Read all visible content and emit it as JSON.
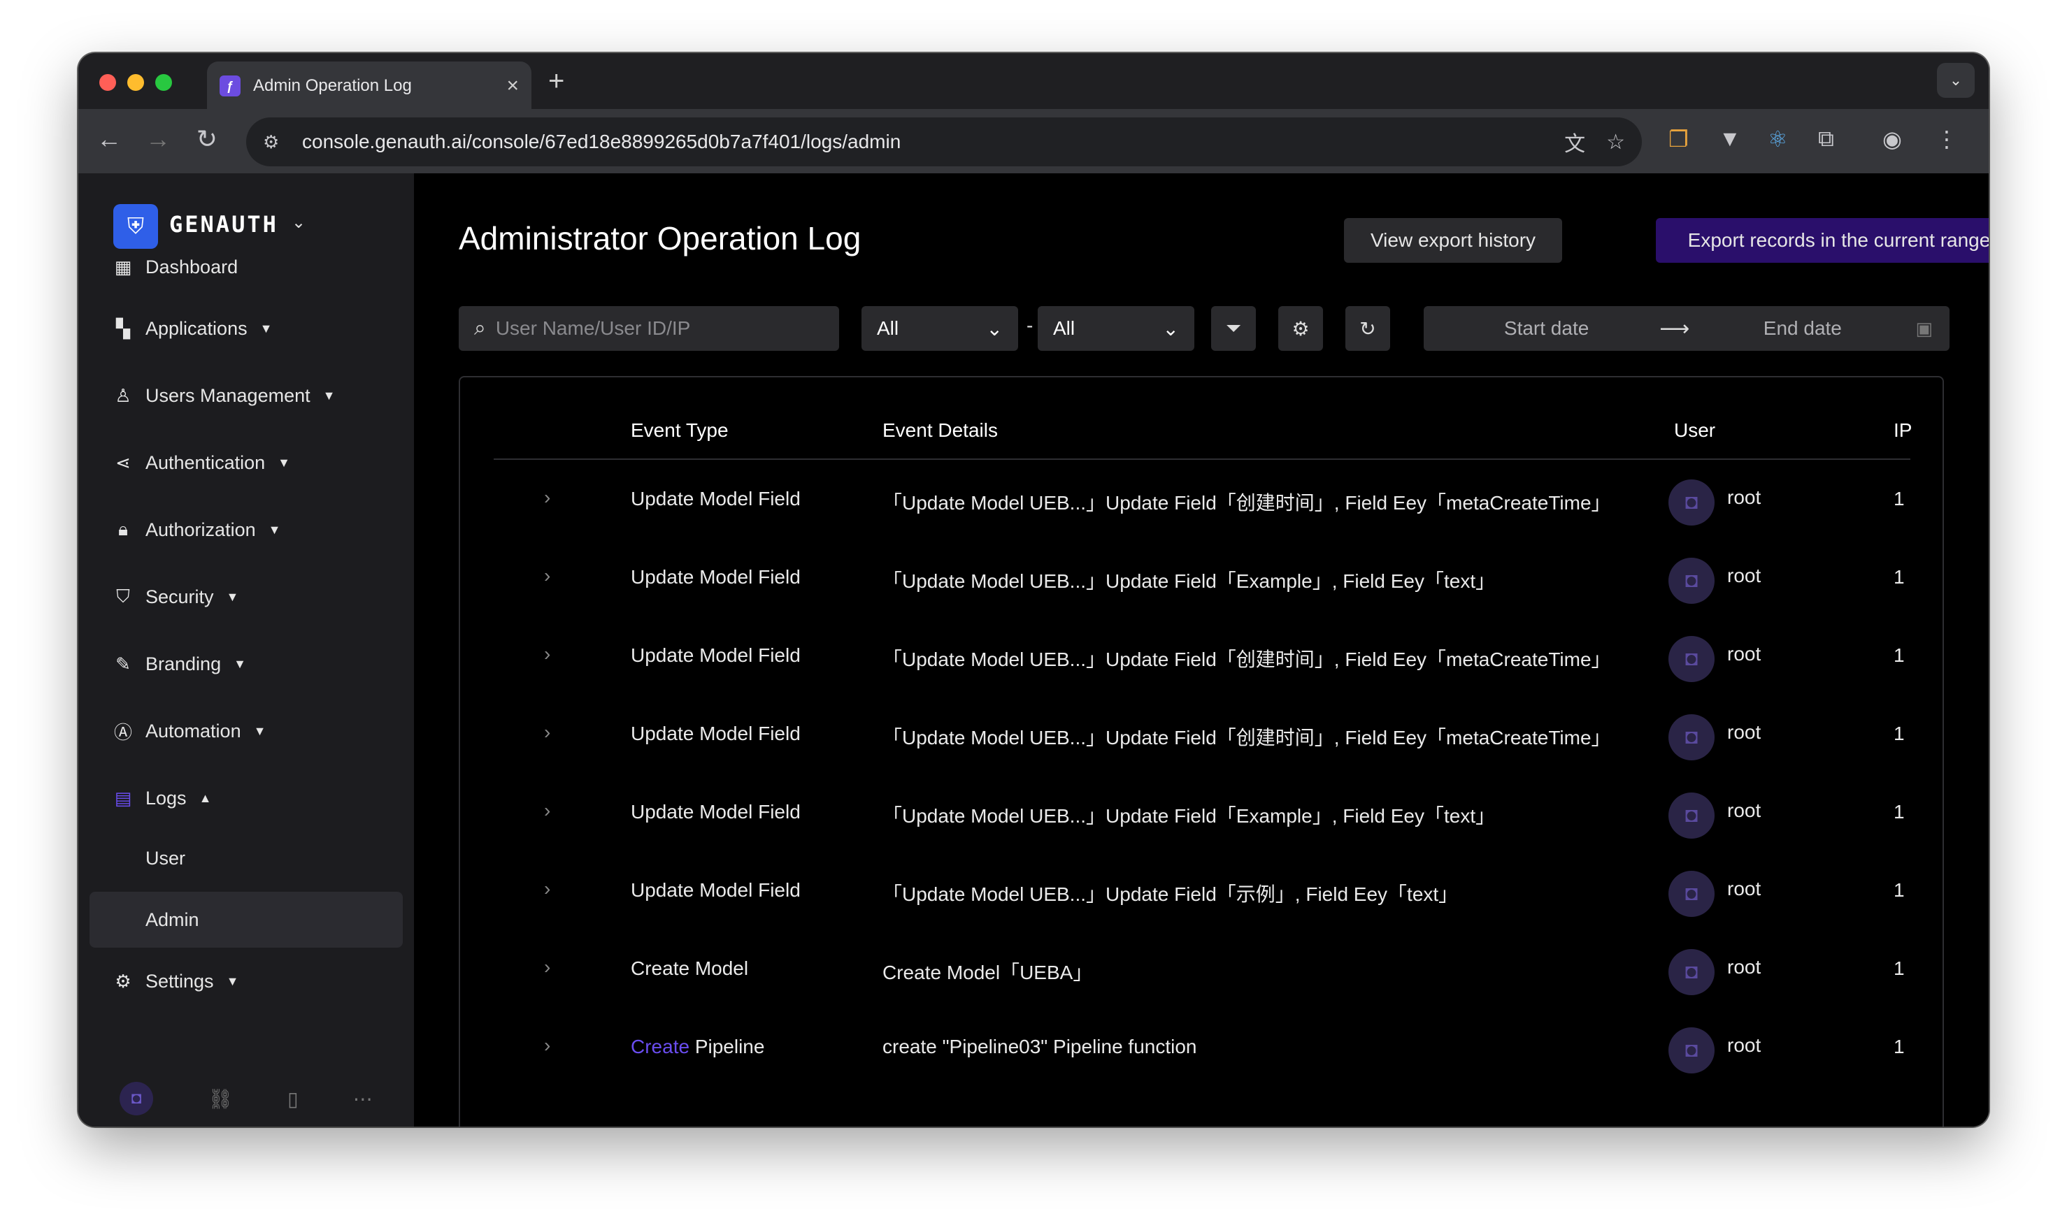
{
  "browser": {
    "tab_title": "Admin Operation Log",
    "tab_close": "×",
    "new_tab": "+",
    "url": "console.genauth.ai/console/67ed18e8899265d0b7a7f401/logs/admin"
  },
  "brand": {
    "logo_text": "GENAUTH",
    "accent_color": "#6a4df0",
    "primary_button_color": "#2a0f6b"
  },
  "sidebar": {
    "items": [
      {
        "label": "Dashboard",
        "icon": "grid-icon"
      },
      {
        "label": "Applications",
        "icon": "apps-icon"
      },
      {
        "label": "Users Management",
        "icon": "user-icon"
      },
      {
        "label": "Authentication",
        "icon": "share-icon"
      },
      {
        "label": "Authorization",
        "icon": "lock-icon"
      },
      {
        "label": "Security",
        "icon": "shield-icon"
      },
      {
        "label": "Branding",
        "icon": "brush-icon"
      },
      {
        "label": "Automation",
        "icon": "automation-icon"
      },
      {
        "label": "Logs",
        "icon": "logs-icon"
      },
      {
        "label": "Settings",
        "icon": "gear-icon"
      }
    ],
    "sub_items": [
      {
        "label": "User"
      },
      {
        "label": "Admin"
      }
    ]
  },
  "page": {
    "title": "Administrator Operation Log",
    "view_export_history": "View export history",
    "export_records": "Export records in the current range"
  },
  "filters": {
    "search_placeholder": "User Name/User ID/IP",
    "select1_value": "All",
    "select2_value": "All",
    "separator": "-",
    "start_date_placeholder": "Start date",
    "end_date_placeholder": "End date"
  },
  "table": {
    "headers": {
      "event_type": "Event Type",
      "event_details": "Event Details",
      "user": "User",
      "ip": "IP"
    },
    "rows": [
      {
        "event_type": "Update Model Field",
        "details": "「Update Model UEB...」Update Field「创建时间」, Field Eey「metaCreateTime」",
        "user": "root",
        "ip": "1"
      },
      {
        "event_type": "Update Model Field",
        "details": "「Update Model UEB...」Update Field「Example」, Field Eey「text」",
        "user": "root",
        "ip": "1"
      },
      {
        "event_type": "Update Model Field",
        "details": "「Update Model UEB...」Update Field「创建时间」, Field Eey「metaCreateTime」",
        "user": "root",
        "ip": "1"
      },
      {
        "event_type": "Update Model Field",
        "details": "「Update Model UEB...」Update Field「创建时间」, Field Eey「metaCreateTime」",
        "user": "root",
        "ip": "1"
      },
      {
        "event_type": "Update Model Field",
        "details": "「Update Model UEB...」Update Field「Example」, Field Eey「text」",
        "user": "root",
        "ip": "1"
      },
      {
        "event_type": "Update Model Field",
        "details": "「Update Model UEB...」Update Field「示例」, Field Eey「text」",
        "user": "root",
        "ip": "1"
      },
      {
        "event_type": "Create Model",
        "details": "Create Model「UEBA」",
        "user": "root",
        "ip": "1"
      },
      {
        "event_type_link": "Create",
        "event_type_rest": " Pipeline",
        "details": "create \"Pipeline03\" Pipeline function",
        "user": "root",
        "ip": "1"
      }
    ]
  }
}
